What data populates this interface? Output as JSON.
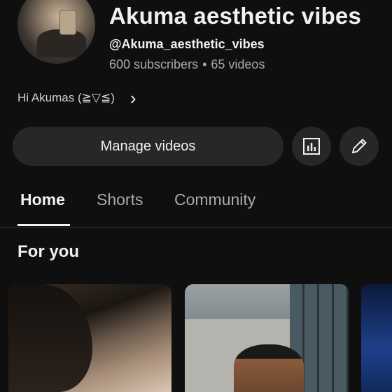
{
  "channel": {
    "name": "Akuma aesthetic vibes",
    "handle": "@Akuma_aesthetic_vibes",
    "subscribers": "600 subscribers",
    "separator": "•",
    "videos": "65 videos",
    "description": "Hi Akumas (≧▽≦)",
    "description_more_icon": "chevron-right-icon"
  },
  "actions": {
    "manage_label": "Manage videos",
    "analytics_icon": "analytics-icon",
    "edit_icon": "pencil-icon"
  },
  "tabs": [
    {
      "label": "Home",
      "active": true
    },
    {
      "label": "Shorts",
      "active": false
    },
    {
      "label": "Community",
      "active": false
    }
  ],
  "section": {
    "title": "For you"
  },
  "colors": {
    "background": "#0f0f0f",
    "button_bg": "#272727",
    "text_primary": "#f1f1f1",
    "text_secondary": "#aaaaaa"
  }
}
